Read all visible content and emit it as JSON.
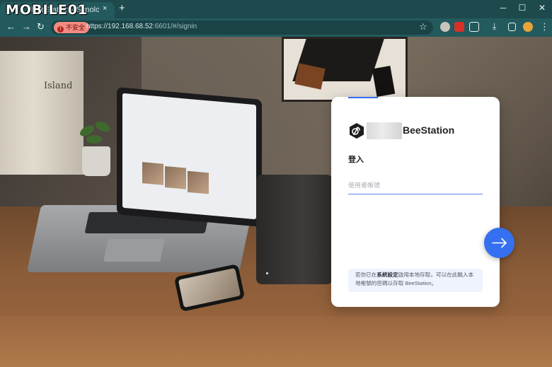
{
  "watermark": {
    "text": "MOBILE01"
  },
  "browser": {
    "tab_title": "BeeStation - Synology",
    "tab_close": "×",
    "new_tab": "+",
    "window": {
      "minimize": "─",
      "maximize": "☐",
      "close": "✕"
    },
    "nav": {
      "back": "←",
      "forward": "→",
      "reload": "↻"
    },
    "security_label": "不安全",
    "url_origin": "https://192.168.68.52",
    "url_path": ":6601/#/signin",
    "bookmark_icon": "star-icon",
    "menu": "⋮"
  },
  "scene": {
    "book_title": "Island"
  },
  "login": {
    "brand": "BeeStation",
    "heading": "登入",
    "username_placeholder": "使用者帳號",
    "next_icon": "arrow-right-icon",
    "notice_pre": "若你已在",
    "notice_bold": "系統設定",
    "notice_post": "啟用本地存取，可以在此輸入本地帳號的密碼以存取 BeeStation。",
    "accent_color": "#3470f0"
  }
}
